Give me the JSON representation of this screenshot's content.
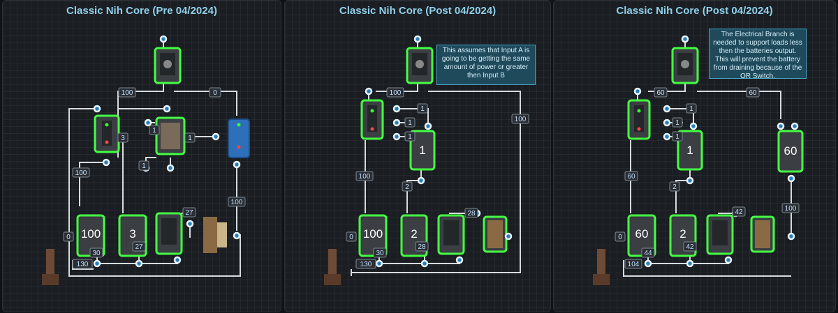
{
  "panels": [
    {
      "title": "Classic Nih Core (Pre 04/2024)",
      "note": "",
      "labels": [
        "100",
        "0",
        "3",
        "1",
        "1",
        "1",
        "100",
        "100",
        "27",
        "30",
        "27",
        "0",
        "130"
      ],
      "battery_values": [
        "100",
        "3"
      ]
    },
    {
      "title": "Classic Nih Core (Post 04/2024)",
      "note": "This assumes that Input A is going to be getting the same amount of power or greater then Input B",
      "labels": [
        "100",
        "1",
        "1",
        "1",
        "100",
        "100",
        "2",
        "28",
        "30",
        "28",
        "0",
        "130"
      ],
      "battery_values": [
        "1",
        "100",
        "2"
      ]
    },
    {
      "title": "Classic Nih Core (Post 04/2024)",
      "note": "The Electrical Branch is needed to support loads less then the batteries output. This will prevent the battery from draining because of the OR Switch.",
      "labels": [
        "60",
        "60",
        "1",
        "1",
        "1",
        "60",
        "2",
        "100",
        "42",
        "44",
        "42",
        "0",
        "104"
      ],
      "battery_values": [
        "1",
        "60",
        "60",
        "2"
      ]
    }
  ],
  "colors": {
    "active_outline": "#44ff44",
    "node": "#2a7fb8",
    "title": "#8fd0ea"
  }
}
